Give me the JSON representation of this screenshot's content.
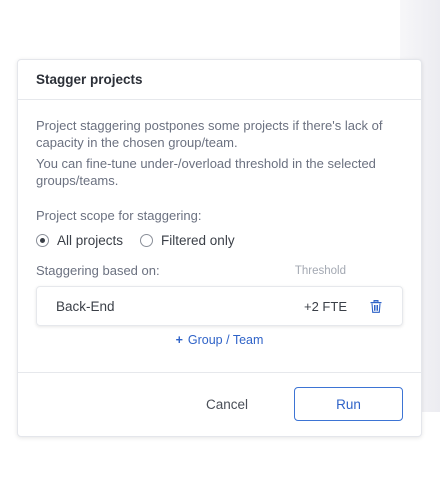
{
  "dialog": {
    "title": "Stagger projects",
    "description_1": "Project staggering postpones some projects if there's lack of capacity in the chosen group/team.",
    "description_2": "You can fine-tune under-/overload threshold in the selected groups/teams.",
    "scope_label": "Project scope for staggering:",
    "scope_options": [
      {
        "label": "All projects",
        "selected": true
      },
      {
        "label": "Filtered only",
        "selected": false
      }
    ],
    "staggering_label": "Staggering based on:",
    "threshold_header": "Threshold",
    "teams": [
      {
        "name": "Back-End",
        "threshold": "+2 FTE",
        "icon": "trash-icon"
      }
    ],
    "add_group": {
      "icon": "+",
      "label": "Group / Team"
    },
    "buttons": {
      "cancel": "Cancel",
      "run": "Run"
    }
  },
  "colors": {
    "accent": "#2f63c8",
    "text": "#3a3f47",
    "muted": "#6b7180"
  }
}
